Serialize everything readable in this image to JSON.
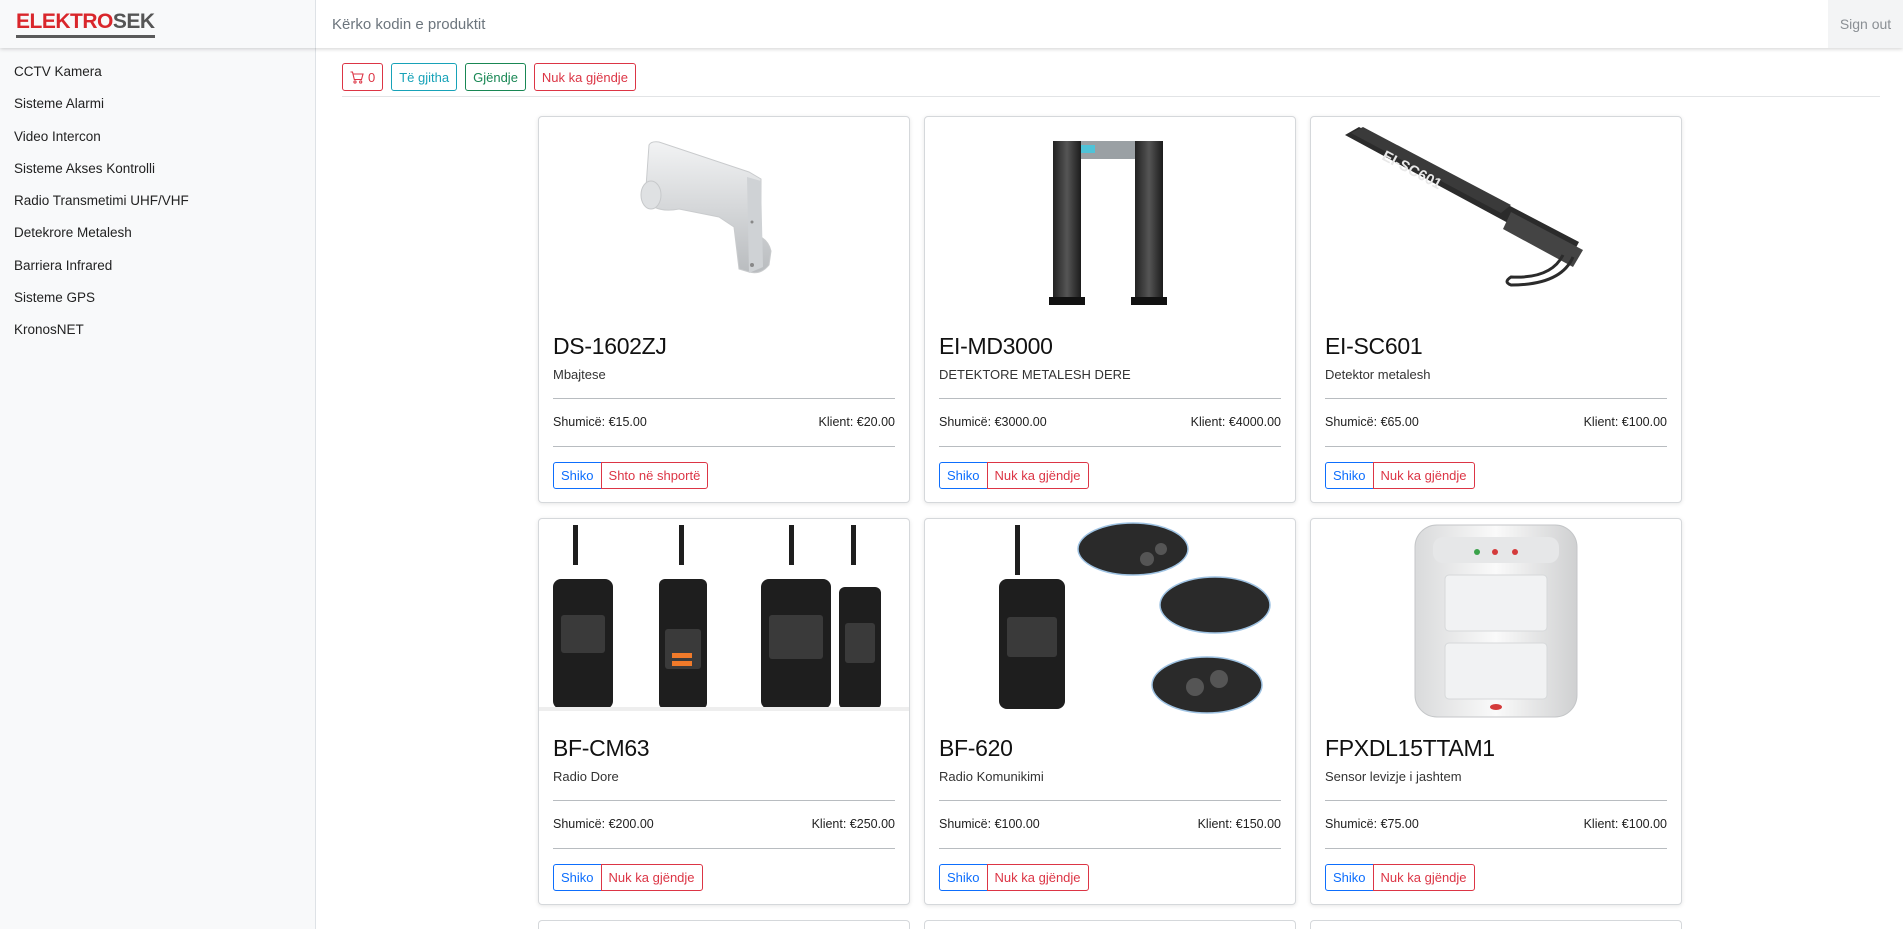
{
  "brand": {
    "part1": "ELEKTRO",
    "part2": "SEK"
  },
  "search": {
    "placeholder": "Kërko kodin e produktit",
    "value": ""
  },
  "header": {
    "signout_label": "Sign out"
  },
  "sidebar": {
    "items": [
      {
        "label": "CCTV Kamera"
      },
      {
        "label": "Sisteme Alarmi"
      },
      {
        "label": "Video Intercon"
      },
      {
        "label": "Sisteme Akses Kontrolli"
      },
      {
        "label": "Radio Transmetimi UHF/VHF"
      },
      {
        "label": "Detekrore Metalesh"
      },
      {
        "label": "Barriera Infrared"
      },
      {
        "label": "Sisteme GPS"
      },
      {
        "label": "KronosNET"
      }
    ]
  },
  "filters": {
    "cart_count": "0",
    "all_label": "Të gjitha",
    "in_stock_label": "Gjëndje",
    "out_of_stock_label": "Nuk ka gjëndje"
  },
  "products": [
    {
      "code": "DS-1602ZJ",
      "description": "Mbajtese",
      "wholesale": "Shumicë: €15.00",
      "client": "Klient: €20.00",
      "view_label": "Shiko",
      "action_label": "Shto në shportë",
      "image": "wall-mount-bracket"
    },
    {
      "code": "EI-MD3000",
      "description": "DETEKTORE METALESH DERE",
      "wholesale": "Shumicë: €3000.00",
      "client": "Klient: €4000.00",
      "view_label": "Shiko",
      "action_label": "Nuk ka gjëndje",
      "image": "walk-through-metal-detector"
    },
    {
      "code": "EI-SC601",
      "description": "Detektor metalesh",
      "wholesale": "Shumicë: €65.00",
      "client": "Klient: €100.00",
      "view_label": "Shiko",
      "action_label": "Nuk ka gjëndje",
      "image": "handheld-metal-detector"
    },
    {
      "code": "BF-CM63",
      "description": "Radio Dore",
      "wholesale": "Shumicë: €200.00",
      "client": "Klient: €250.00",
      "view_label": "Shiko",
      "action_label": "Nuk ka gjëndje",
      "image": "radios-set"
    },
    {
      "code": "BF-620",
      "description": "Radio Komunikimi",
      "wholesale": "Shumicë: €100.00",
      "client": "Klient: €150.00",
      "view_label": "Shiko",
      "action_label": "Nuk ka gjëndje",
      "image": "radio-with-details"
    },
    {
      "code": "FPXDL15TTAM1",
      "description": "Sensor levizje i jashtem",
      "wholesale": "Shumicë: €75.00",
      "client": "Klient: €100.00",
      "view_label": "Shiko",
      "action_label": "Nuk ka gjëndje",
      "image": "motion-sensor"
    }
  ],
  "colors": {
    "brand_red": "#d9262b",
    "primary": "#0d6efd",
    "danger": "#dc3545",
    "info": "#17a2b8",
    "success": "#198754"
  }
}
